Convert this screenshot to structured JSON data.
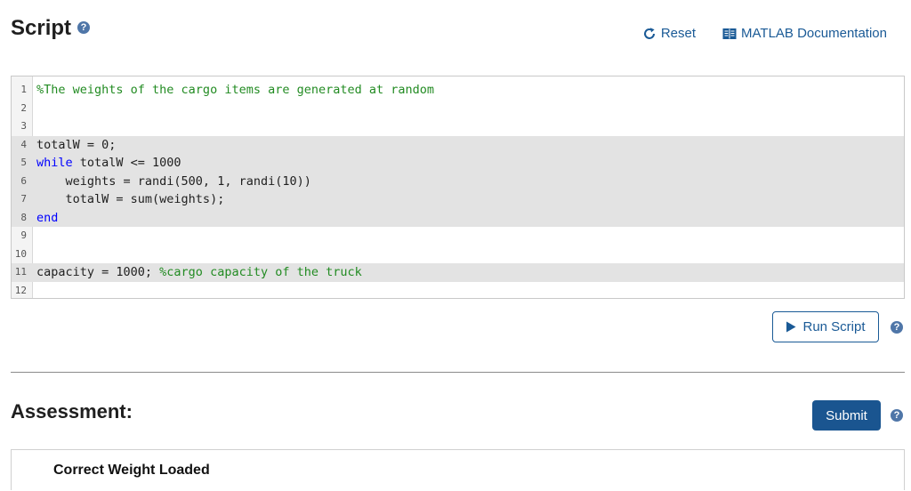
{
  "script_header": {
    "title": "Script",
    "help_glyph": "?",
    "icon": "help-icon"
  },
  "toolbar": {
    "reset_label": "Reset",
    "reset_icon": "reset-icon",
    "docs_label": "MATLAB Documentation",
    "docs_icon": "book-icon"
  },
  "editor": {
    "lines": [
      {
        "num": "1",
        "highlighted": false,
        "tokens": [
          {
            "type": "comment",
            "text": "%The weights of the cargo items are generated at random"
          }
        ]
      },
      {
        "num": "2",
        "highlighted": false,
        "tokens": []
      },
      {
        "num": "3",
        "highlighted": false,
        "tokens": []
      },
      {
        "num": "4",
        "highlighted": true,
        "tokens": [
          {
            "type": "plain",
            "text": "totalW = 0;"
          }
        ]
      },
      {
        "num": "5",
        "highlighted": true,
        "tokens": [
          {
            "type": "keyword",
            "text": "while"
          },
          {
            "type": "plain",
            "text": " totalW <= 1000"
          }
        ]
      },
      {
        "num": "6",
        "highlighted": true,
        "tokens": [
          {
            "type": "plain",
            "text": "    weights = randi(500, 1, randi(10))"
          }
        ]
      },
      {
        "num": "7",
        "highlighted": true,
        "tokens": [
          {
            "type": "plain",
            "text": "    totalW = sum(weights);"
          }
        ]
      },
      {
        "num": "8",
        "highlighted": true,
        "tokens": [
          {
            "type": "keyword",
            "text": "end"
          }
        ]
      },
      {
        "num": "9",
        "highlighted": false,
        "tokens": []
      },
      {
        "num": "10",
        "highlighted": false,
        "tokens": []
      },
      {
        "num": "11",
        "highlighted": true,
        "tokens": [
          {
            "type": "plain",
            "text": "capacity = 1000; "
          },
          {
            "type": "comment",
            "text": "%cargo capacity of the truck"
          }
        ]
      },
      {
        "num": "12",
        "highlighted": false,
        "tokens": []
      }
    ],
    "colors": {
      "comment": "#228b22",
      "keyword": "#0000ff",
      "highlight": "#e3e3e3"
    }
  },
  "actions": {
    "run_label": "Run Script",
    "run_icon": "play-icon",
    "submit_label": "Submit",
    "help_glyph": "?"
  },
  "assessment": {
    "title": "Assessment:",
    "items": [
      "Correct Weight Loaded"
    ]
  },
  "colors": {
    "accent": "#1a5a96",
    "submit_bg": "#1a5590",
    "help_icon": "#4f76a8"
  }
}
